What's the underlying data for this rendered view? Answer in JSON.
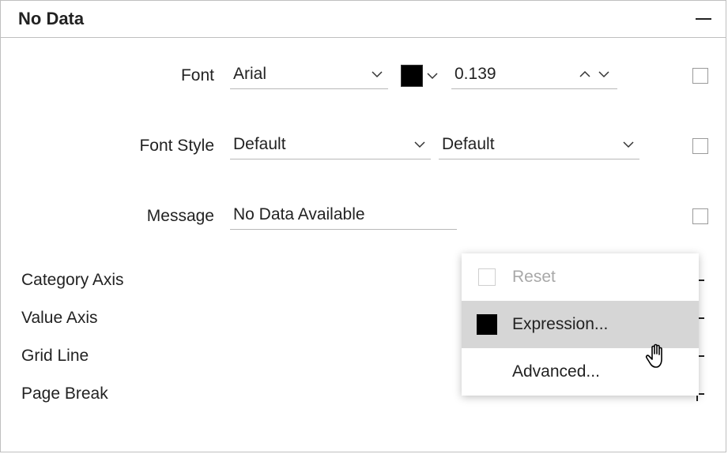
{
  "header": {
    "title": "No Data"
  },
  "fields": {
    "font": {
      "label": "Font",
      "family": "Arial",
      "size": "0.139"
    },
    "fontStyle": {
      "label": "Font Style",
      "value1": "Default",
      "value2": "Default"
    },
    "message": {
      "label": "Message",
      "value": "No Data Available"
    }
  },
  "sections": {
    "categoryAxis": "Category Axis",
    "valueAxis": "Value Axis",
    "gridLine": "Grid Line",
    "pageBreak": "Page Break"
  },
  "menu": {
    "reset": "Reset",
    "expression": "Expression...",
    "advanced": "Advanced..."
  }
}
